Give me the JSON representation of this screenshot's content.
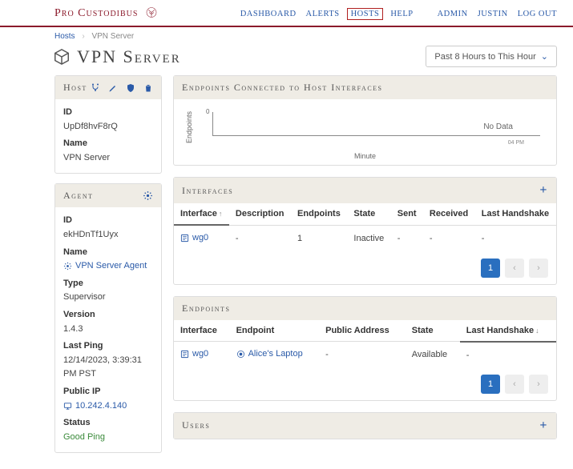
{
  "brand": "Pro Custodibus",
  "nav": {
    "dashboard": "DASHBOARD",
    "alerts": "ALERTS",
    "hosts": "HOSTS",
    "help": "HELP",
    "admin": "ADMIN",
    "user": "JUSTIN",
    "logout": "LOG OUT"
  },
  "crumbs": {
    "hosts": "Hosts",
    "current": "VPN Server"
  },
  "page_title": "VPN Server",
  "time_selector": "Past 8 Hours to This Hour",
  "host_panel": {
    "title": "Host",
    "id_label": "ID",
    "id": "UpDf8hvF8rQ",
    "name_label": "Name",
    "name": "VPN Server"
  },
  "agent_panel": {
    "title": "Agent",
    "id_label": "ID",
    "id": "ekHDnTf1Uyx",
    "name_label": "Name",
    "name": "VPN Server Agent",
    "type_label": "Type",
    "type": "Supervisor",
    "version_label": "Version",
    "version": "1.4.3",
    "lastping_label": "Last Ping",
    "lastping": "12/14/2023, 3:39:31 PM PST",
    "publicip_label": "Public IP",
    "publicip": "10.242.4.140",
    "status_label": "Status",
    "status": "Good Ping"
  },
  "chart_panel": {
    "title": "Endpoints Connected to Host Interfaces"
  },
  "chart_data": {
    "type": "line",
    "title": "Endpoints Connected to Host Interfaces",
    "xlabel": "Minute",
    "ylabel": "Endpoints",
    "ylim": [
      0,
      1
    ],
    "ticks_x": [
      "04 PM"
    ],
    "ticks_y": [
      "0"
    ],
    "series": [],
    "nodata_text": "No Data"
  },
  "interfaces_panel": {
    "title": "Interfaces",
    "cols": {
      "interface": "Interface",
      "description": "Description",
      "endpoints": "Endpoints",
      "state": "State",
      "sent": "Sent",
      "received": "Received",
      "handshake": "Last Handshake"
    },
    "row": {
      "interface": "wg0",
      "description": "-",
      "endpoints": "1",
      "state": "Inactive",
      "sent": "-",
      "received": "-",
      "handshake": "-"
    },
    "page": "1"
  },
  "endpoints_panel": {
    "title": "Endpoints",
    "cols": {
      "interface": "Interface",
      "endpoint": "Endpoint",
      "public": "Public Address",
      "state": "State",
      "handshake": "Last Handshake"
    },
    "row": {
      "interface": "wg0",
      "endpoint": "Alice's Laptop",
      "public": "-",
      "state": "Available",
      "handshake": "-"
    },
    "page": "1"
  },
  "users_panel": {
    "title": "Users"
  }
}
